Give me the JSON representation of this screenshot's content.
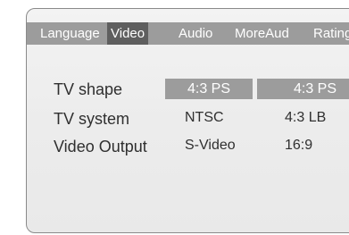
{
  "tabs": {
    "language": "Language",
    "video": "Video",
    "audio": "Audio",
    "moreaud": "MoreAud",
    "rating": "Rating"
  },
  "settings": [
    {
      "label": "TV shape",
      "value": "4:3 PS"
    },
    {
      "label": "TV system",
      "value": "NTSC"
    },
    {
      "label": "Video Output",
      "value": "S-Video"
    }
  ],
  "options": [
    "4:3 PS",
    "4:3 LB",
    "16:9"
  ],
  "colors": {
    "tabbar": "#9c9c9c",
    "active_tab": "#5f5f5f",
    "panel_bg": "#ececec",
    "text": "#2f2f2f",
    "selected_text": "#ffffff"
  }
}
